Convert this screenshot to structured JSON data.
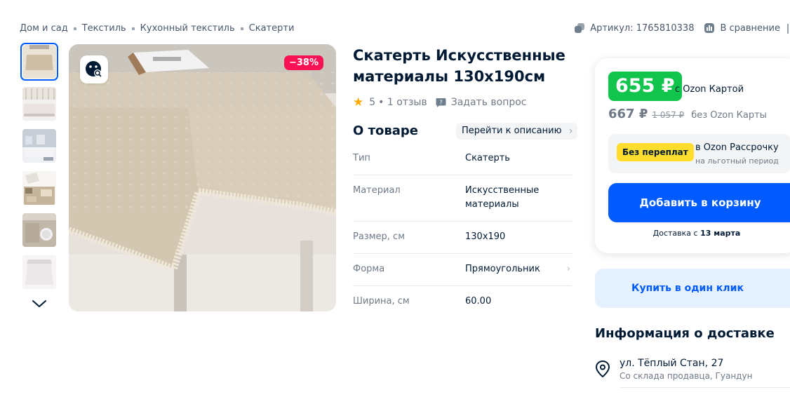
{
  "breadcrumb": [
    "Дом и сад",
    "Текстиль",
    "Кухонный текстиль",
    "Скатерти"
  ],
  "header_right": {
    "article": "Артикул: 1765810338",
    "compare": "В сравнение"
  },
  "gallery": {
    "thumb_count": 6,
    "active_thumb": 0,
    "discount_badge": "−38%"
  },
  "product": {
    "title": "Скатерть Искусственные материалы 130x190см",
    "rating": "5",
    "reviews": "• 1 отзыв",
    "ask_question": "Задать вопрос"
  },
  "about": {
    "title": "О товаре",
    "goto_description": "Перейти к описанию",
    "specs": [
      {
        "key": "Тип",
        "value": "Скатерть"
      },
      {
        "key": "Материал",
        "value": "Искусственные материалы"
      },
      {
        "key": "Размер, см",
        "value": "130x190"
      },
      {
        "key": "Форма",
        "value": "Прямоугольник"
      },
      {
        "key": "Ширина, см",
        "value": "60.00"
      }
    ]
  },
  "price": {
    "ozon_price": "655 ₽",
    "ozon_note": "с Ozon Картой",
    "regular_price": "667 ₽",
    "old_price": "1 057 ₽",
    "regular_note": "без Ozon Карты",
    "installment_badge": "Без переплат",
    "installment_title": "в Ozon Рассрочку",
    "installment_subtitle": "на льготный период",
    "add_to_cart": "Добавить в корзину",
    "delivery_prefix": "Доставка с ",
    "delivery_date": "13 марта"
  },
  "one_click": "Купить в один клик",
  "delivery_info": {
    "title": "Информация о доставке",
    "address": "ул. Тёплый Стан, 27",
    "source": "Со склада продавца, Гуандун"
  },
  "colors": {
    "accent": "#005bff",
    "green": "#10c44c",
    "discount": "#f91155",
    "yellow": "#ffdd2d"
  }
}
